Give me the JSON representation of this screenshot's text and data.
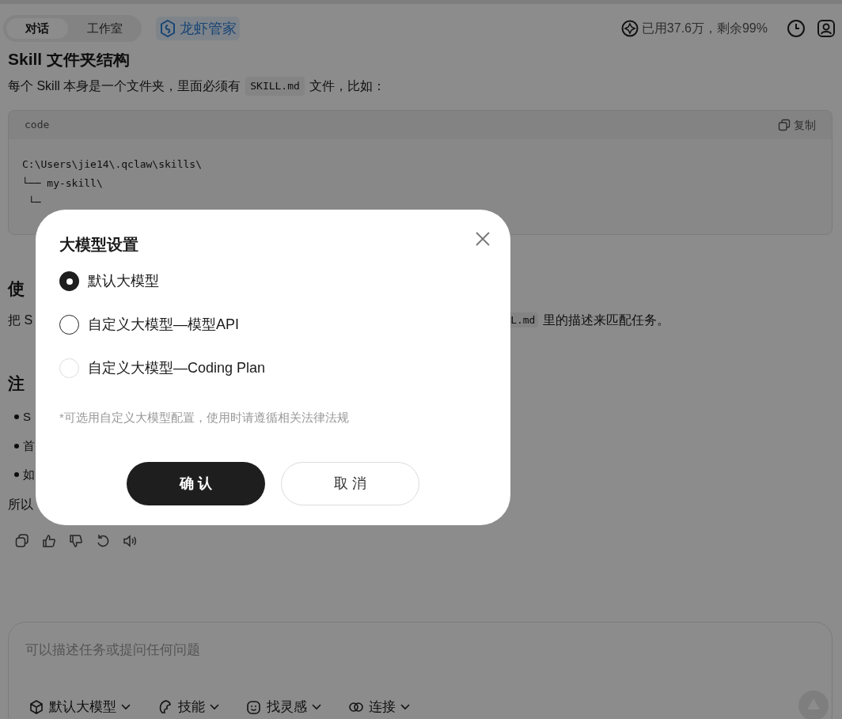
{
  "header": {
    "tabs": [
      {
        "label": "对话",
        "selected": true
      },
      {
        "label": "工作室",
        "selected": false
      }
    ],
    "brand": "龙虾管家",
    "usage": "已用37.6万，剩余99%"
  },
  "content": {
    "heading": "Skill 文件夹结构",
    "intro": {
      "before": "每个 Skill 本身是一个文件夹，里面必须有",
      "code": "SKILL.md",
      "after": "文件，比如："
    },
    "code_block": {
      "language": "code",
      "copy_label": "复制",
      "lines": [
        "C:\\Users\\jie14\\.qclaw\\skills\\",
        "└── my-skill\\",
        "└─"
      ]
    },
    "heading_2": "使",
    "para_left": "把 S",
    "para_code": "L.md",
    "para_right": "里的描述来匹配任务。",
    "heading_3": "注",
    "bullets": [
      "S",
      "首",
      "如"
    ],
    "closing": "所以"
  },
  "input": {
    "placeholder": "可以描述任务或提问任何问题",
    "tools": [
      {
        "kind": "model",
        "label": "默认大模型"
      },
      {
        "kind": "skill",
        "label": "技能"
      },
      {
        "kind": "idea",
        "label": "找灵感"
      },
      {
        "kind": "connect",
        "label": "连接"
      }
    ]
  },
  "dialog": {
    "title": "大模型设置",
    "options": [
      {
        "label": "默认大模型",
        "selected": true,
        "hovered": false
      },
      {
        "label": "自定义大模型—模型API",
        "selected": false,
        "hovered": true
      },
      {
        "label": "自定义大模型—Coding Plan",
        "selected": false,
        "hovered": false
      }
    ],
    "note": "*可选用自定义大模型配置，使用时请遵循相关法律法规",
    "confirm": "确 认",
    "cancel": "取 消"
  }
}
